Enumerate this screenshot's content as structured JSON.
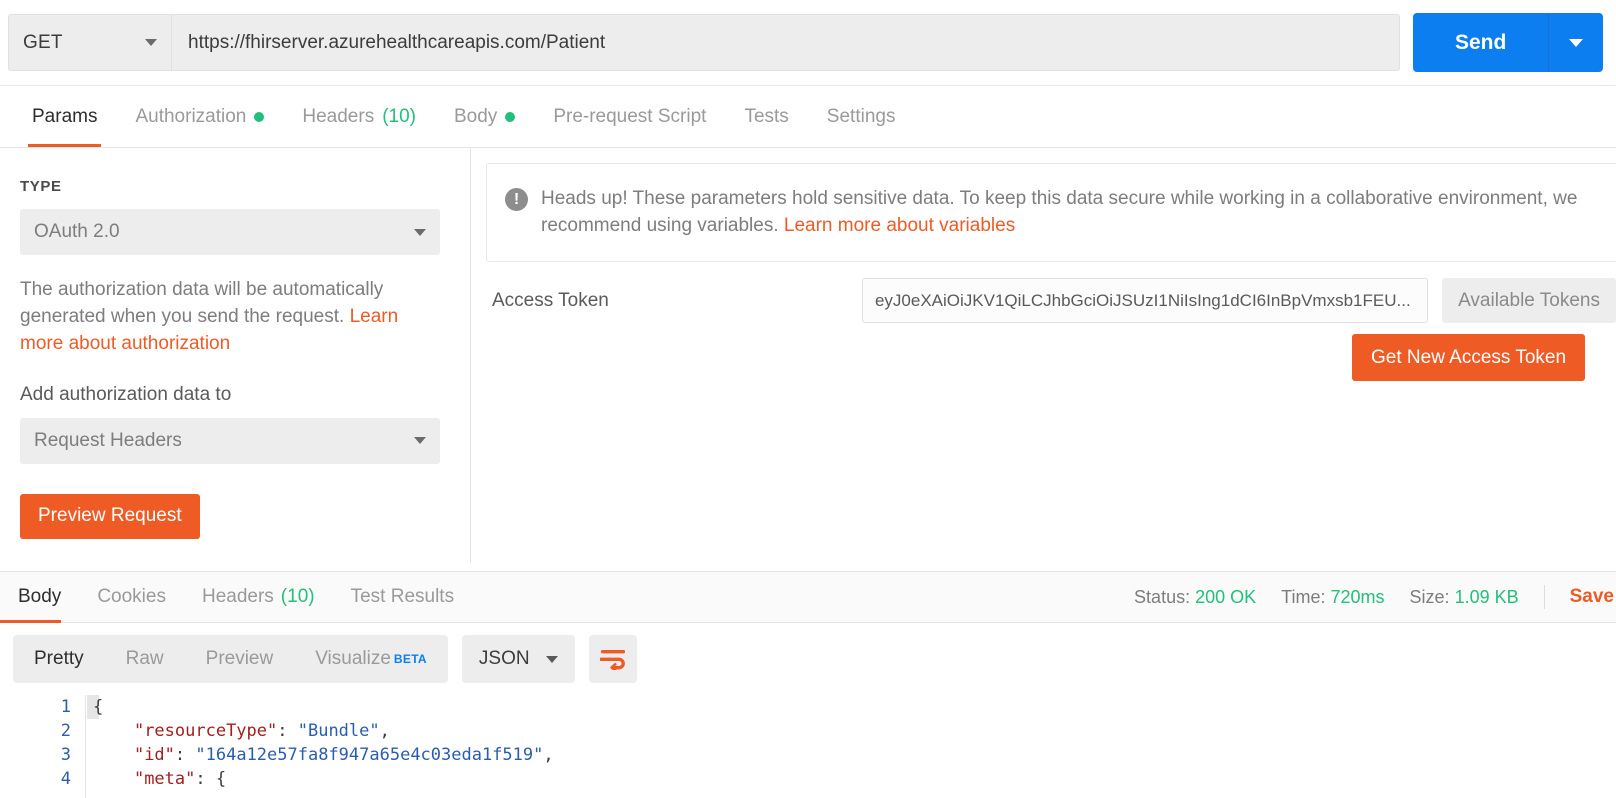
{
  "request": {
    "method": "GET",
    "url": "https://fhirserver.azurehealthcareapis.com/Patient",
    "send_label": "Send",
    "tabs": [
      {
        "label": "Params",
        "active": false,
        "dot": false,
        "count": null
      },
      {
        "label": "Authorization",
        "active": true,
        "dot": true,
        "count": null
      },
      {
        "label": "Headers",
        "active": false,
        "dot": false,
        "count": "(10)"
      },
      {
        "label": "Body",
        "active": false,
        "dot": true,
        "count": null
      },
      {
        "label": "Pre-request Script",
        "active": false,
        "dot": false,
        "count": null
      },
      {
        "label": "Tests",
        "active": false,
        "dot": false,
        "count": null
      },
      {
        "label": "Settings",
        "active": false,
        "dot": false,
        "count": null
      }
    ]
  },
  "auth": {
    "type_label": "TYPE",
    "type_value": "OAuth 2.0",
    "description_text": "The authorization data will be automatically generated when you send the request. ",
    "description_link": "Learn more about authorization",
    "add_to_label": "Add authorization data to",
    "add_to_value": "Request Headers",
    "preview_button": "Preview Request",
    "notice_text": "Heads up! These parameters hold sensitive data. To keep this data secure while working in a collaborative environment, we recommend using variables. ",
    "notice_link": "Learn more about variables",
    "token_label": "Access Token",
    "token_value": "eyJ0eXAiOiJKV1QiLCJhbGciOiJSUzI1NiIsIng1dCI6InBpVmxsb1FEU...",
    "available_tokens_button": "Available Tokens",
    "get_new_token_button": "Get New Access Token"
  },
  "response": {
    "tabs": [
      {
        "label": "Body",
        "active": true,
        "count": null
      },
      {
        "label": "Cookies",
        "active": false,
        "count": null
      },
      {
        "label": "Headers",
        "active": false,
        "count": "(10)"
      },
      {
        "label": "Test Results",
        "active": false,
        "count": null
      }
    ],
    "status_label": "Status:",
    "status_value": "200 OK",
    "time_label": "Time:",
    "time_value": "720ms",
    "size_label": "Size:",
    "size_value": "1.09 KB",
    "save_label": "Save",
    "format_tabs": [
      {
        "label": "Pretty",
        "active": true
      },
      {
        "label": "Raw",
        "active": false
      },
      {
        "label": "Preview",
        "active": false
      },
      {
        "label": "Visualize",
        "active": false,
        "badge": "BETA"
      }
    ],
    "language": "JSON",
    "body_lines": [
      {
        "n": "1",
        "parts": [
          {
            "t": "{",
            "c": "p"
          }
        ]
      },
      {
        "n": "2",
        "parts": [
          {
            "t": "    ",
            "c": "p"
          },
          {
            "t": "\"resourceType\"",
            "c": "k"
          },
          {
            "t": ": ",
            "c": "p"
          },
          {
            "t": "\"Bundle\"",
            "c": "s"
          },
          {
            "t": ",",
            "c": "p"
          }
        ]
      },
      {
        "n": "3",
        "parts": [
          {
            "t": "    ",
            "c": "p"
          },
          {
            "t": "\"id\"",
            "c": "k"
          },
          {
            "t": ": ",
            "c": "p"
          },
          {
            "t": "\"164a12e57fa8f947a65e4c03eda1f519\"",
            "c": "s"
          },
          {
            "t": ",",
            "c": "p"
          }
        ]
      },
      {
        "n": "4",
        "parts": [
          {
            "t": "    ",
            "c": "p"
          },
          {
            "t": "\"meta\"",
            "c": "k"
          },
          {
            "t": ": {",
            "c": "p"
          }
        ]
      }
    ]
  },
  "colors": {
    "accent_orange": "#ef5b25",
    "send_blue": "#0d7eef",
    "status_green": "#22c07b"
  }
}
